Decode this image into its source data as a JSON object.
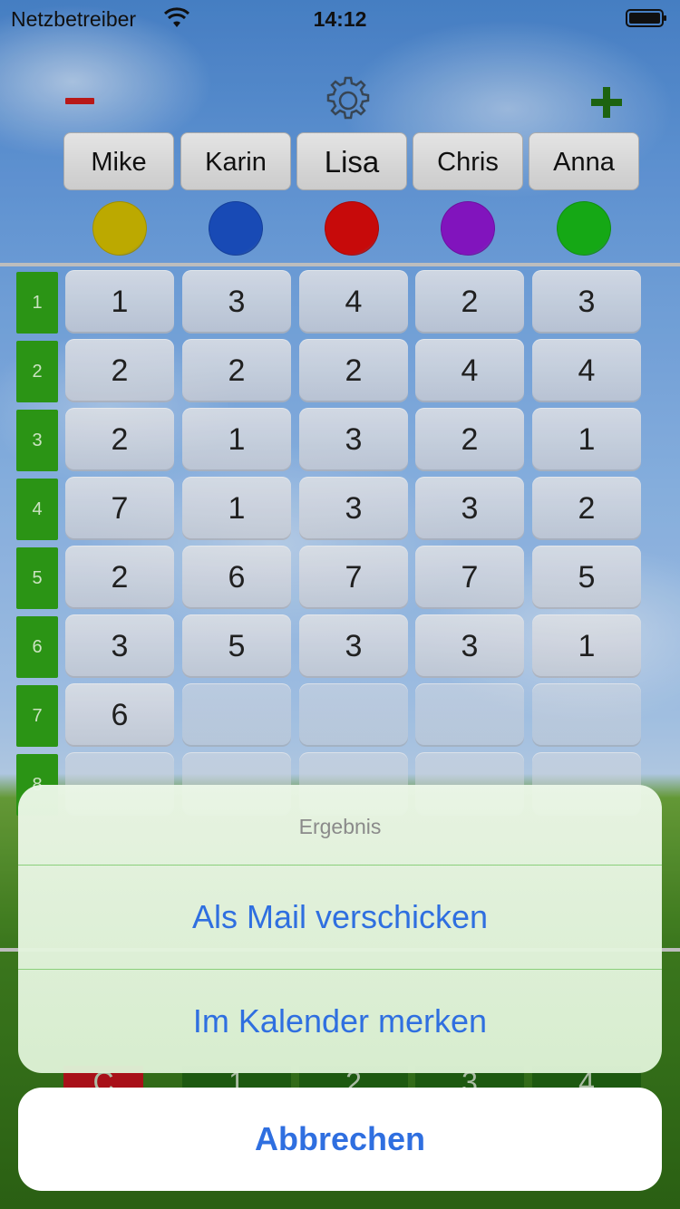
{
  "status_bar": {
    "carrier": "Netzbetreiber",
    "time": "14:12"
  },
  "players": [
    {
      "name": "Mike",
      "color": "#c8b400"
    },
    {
      "name": "Karin",
      "color": "#1a4fc1"
    },
    {
      "name": "Lisa",
      "color": "#d40b0b"
    },
    {
      "name": "Chris",
      "color": "#8a16c9"
    },
    {
      "name": "Anna",
      "color": "#17b317"
    }
  ],
  "rows": [
    {
      "label": "1",
      "cells": [
        "1",
        "3",
        "4",
        "2",
        "3"
      ]
    },
    {
      "label": "2",
      "cells": [
        "2",
        "2",
        "2",
        "4",
        "4"
      ]
    },
    {
      "label": "3",
      "cells": [
        "2",
        "1",
        "3",
        "2",
        "1"
      ]
    },
    {
      "label": "4",
      "cells": [
        "7",
        "1",
        "3",
        "3",
        "2"
      ]
    },
    {
      "label": "5",
      "cells": [
        "2",
        "6",
        "7",
        "7",
        "5"
      ]
    },
    {
      "label": "6",
      "cells": [
        "3",
        "5",
        "3",
        "3",
        "1"
      ]
    },
    {
      "label": "7",
      "cells": [
        "6",
        "",
        "",
        "",
        ""
      ]
    },
    {
      "label": "8",
      "cells": [
        "",
        "",
        "",
        "",
        ""
      ]
    }
  ],
  "bottom_strip": [
    "C",
    "1",
    "2",
    "3",
    "4"
  ],
  "action_sheet": {
    "title": "Ergebnis",
    "actions": [
      "Als Mail verschicken",
      "Im Kalender merken"
    ],
    "cancel": "Abbrechen"
  }
}
